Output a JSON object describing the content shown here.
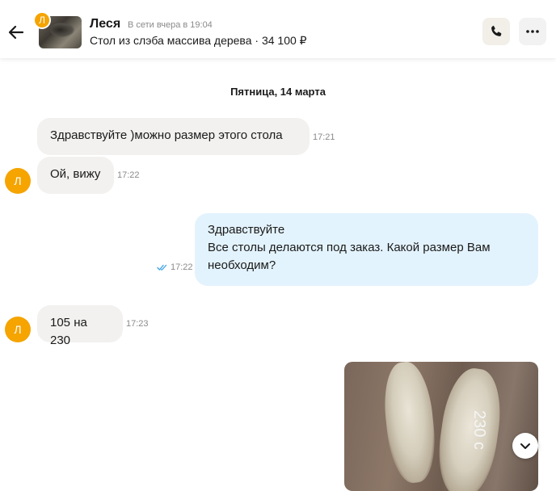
{
  "header": {
    "contact_name": "Леся",
    "status": "В сети вчера в 19:04",
    "item_title": "Стол из слэба массива дерева · 34 100 ₽",
    "avatar_letter": "Л"
  },
  "date_separator": "Пятница, 14 марта",
  "messages": [
    {
      "text": "Здравствуйте )можно размер этого стола",
      "time": "17:21"
    },
    {
      "text": "Ой, вижу",
      "time": "17:22"
    },
    {
      "lines": [
        "Здравствуйте",
        "Все столы делаются под заказ. Какой размер Вам",
        "необходим?"
      ],
      "time": "17:22"
    },
    {
      "text": "105 на 230",
      "time": "17:23"
    }
  ],
  "photo": {
    "label": "230 с"
  },
  "colors": {
    "accent_orange": "#f5a400",
    "outgoing_bubble": "#e3f3fd",
    "incoming_bubble": "#f2f1ef",
    "read_ticks": "#3aa0e8"
  }
}
